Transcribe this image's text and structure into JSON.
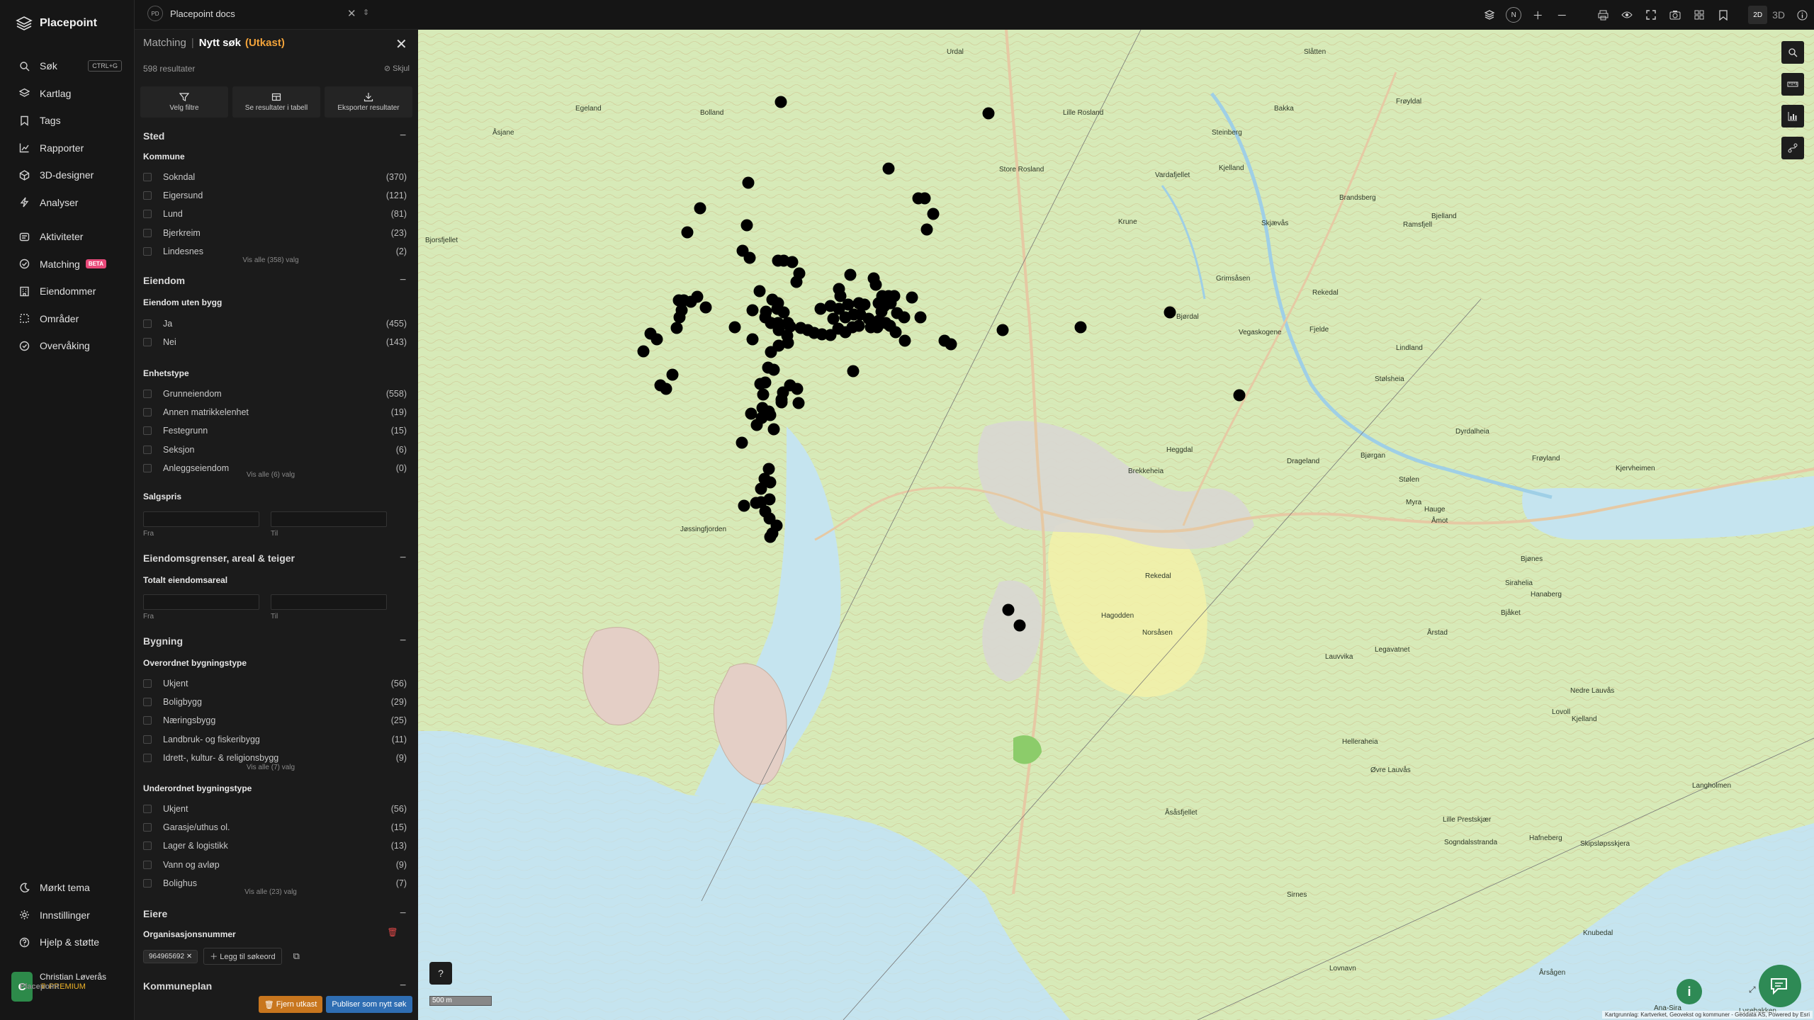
{
  "app": {
    "name": "Placepoint"
  },
  "sidebar": {
    "nav": [
      {
        "label": "Søk",
        "icon": "search-icon",
        "shortcut": "CTRL+G"
      },
      {
        "label": "Kartlag",
        "icon": "layers-icon"
      },
      {
        "label": "Tags",
        "icon": "bookmark-icon"
      },
      {
        "label": "Rapporter",
        "icon": "chart-icon"
      },
      {
        "label": "3D-designer",
        "icon": "cube-icon"
      },
      {
        "label": "Analyser",
        "icon": "bolt-icon"
      }
    ],
    "nav2": [
      {
        "label": "Aktiviteter",
        "icon": "activity-icon"
      },
      {
        "label": "Matching",
        "icon": "target-icon",
        "badge": "BETA"
      },
      {
        "label": "Eiendommer",
        "icon": "building-icon"
      },
      {
        "label": "Områder",
        "icon": "area-icon"
      },
      {
        "label": "Overvåking",
        "icon": "monitor-icon"
      }
    ],
    "nav3": [
      {
        "label": "Mørkt tema",
        "icon": "moon-icon"
      },
      {
        "label": "Innstillinger",
        "icon": "gear-icon"
      },
      {
        "label": "Hjelp & støtte",
        "icon": "help-icon"
      }
    ],
    "user": {
      "initial": "C",
      "name": "Christian Løverås",
      "org": "Placepoint",
      "plan": "PREMIUM"
    }
  },
  "topbar": {
    "workspace_initials": "PD",
    "workspace": "Placepoint docs",
    "compass": "N",
    "mode_2d": "2D",
    "mode_3d": "3D"
  },
  "panel": {
    "crumb": "Matching",
    "title": "Nytt søk",
    "draft": "(Utkast)",
    "result_count": "598 resultater",
    "hide_label": "Skjul",
    "actions": [
      "Velg filtre",
      "Se resultater i tabell",
      "Eksporter resultater"
    ],
    "sted": {
      "title": "Sted",
      "kommune_label": "Kommune",
      "kommune": [
        {
          "label": "Sokndal",
          "count": "(370)"
        },
        {
          "label": "Eigersund",
          "count": "(121)"
        },
        {
          "label": "Lund",
          "count": "(81)"
        },
        {
          "label": "Bjerkreim",
          "count": "(23)"
        },
        {
          "label": "Lindesnes",
          "count": "(2)"
        }
      ],
      "vis_alle": "Vis alle (358) valg"
    },
    "eiendom": {
      "title": "Eiendom",
      "uten_bygg_label": "Eiendom uten bygg",
      "uten_bygg": [
        {
          "label": "Ja",
          "count": "(455)"
        },
        {
          "label": "Nei",
          "count": "(143)"
        }
      ],
      "enhetstype_label": "Enhetstype",
      "enhetstype": [
        {
          "label": "Grunneiendom",
          "count": "(558)"
        },
        {
          "label": "Annen matrikkelenhet",
          "count": "(19)"
        },
        {
          "label": "Festegrunn",
          "count": "(15)"
        },
        {
          "label": "Seksjon",
          "count": "(6)"
        },
        {
          "label": "Anleggseiendom",
          "count": "(0)"
        }
      ],
      "enhetstype_vis_alle": "Vis alle (6) valg",
      "salgspris_label": "Salgspris",
      "fra": "Fra",
      "til": "Til"
    },
    "grenser": {
      "title": "Eiendomsgrenser, areal & teiger",
      "areal_label": "Totalt eiendomsareal",
      "fra": "Fra",
      "til": "Til"
    },
    "bygning": {
      "title": "Bygning",
      "overordnet_label": "Overordnet bygningstype",
      "overordnet": [
        {
          "label": "Ukjent",
          "count": "(56)"
        },
        {
          "label": "Boligbygg",
          "count": "(29)"
        },
        {
          "label": "Næringsbygg",
          "count": "(25)"
        },
        {
          "label": "Landbruk- og fiskeribygg",
          "count": "(11)"
        },
        {
          "label": "Idrett-, kultur- & religionsbygg",
          "count": "(9)"
        }
      ],
      "overordnet_vis_alle": "Vis alle (7) valg",
      "underordnet_label": "Underordnet bygningstype",
      "underordnet": [
        {
          "label": "Ukjent",
          "count": "(56)"
        },
        {
          "label": "Garasje/uthus ol.",
          "count": "(15)"
        },
        {
          "label": "Lager & logistikk",
          "count": "(13)"
        },
        {
          "label": "Vann og avløp",
          "count": "(9)"
        },
        {
          "label": "Bolighus",
          "count": "(7)"
        }
      ],
      "underordnet_vis_alle": "Vis alle (23) valg"
    },
    "eiere": {
      "title": "Eiere",
      "org_label": "Organisasjonsnummer",
      "org_value": "964965692",
      "add_keyword": "Legg til søkeord"
    },
    "kommuneplan": {
      "title": "Kommuneplan"
    },
    "btn_remove": "Fjern utkast",
    "btn_publish": "Publiser som nytt søk"
  },
  "map": {
    "scale_label": "500 m",
    "attribution": "Kartgrunnlag: Kartverket, Geovekst og kommuner - Geodata AS, Powered by Esri",
    "place_labels": [
      {
        "label": "Slåtten"
      },
      {
        "label": "Urdal"
      },
      {
        "label": "Egeland"
      },
      {
        "label": "Bolland"
      },
      {
        "label": "Lille Rosland"
      },
      {
        "label": "Bakka"
      },
      {
        "label": "Frøyldal"
      },
      {
        "label": "Åsjane"
      },
      {
        "label": "Steinberg"
      },
      {
        "label": "Kjelland"
      },
      {
        "label": "Bjorsfjellet"
      },
      {
        "label": "Store Rosland"
      },
      {
        "label": "Vardafjellet"
      },
      {
        "label": "Brandsberg"
      },
      {
        "label": "Bjelland"
      },
      {
        "label": "Skjævås"
      },
      {
        "label": "Bjørdal"
      },
      {
        "label": "Ramsfjell"
      },
      {
        "label": "Krune"
      },
      {
        "label": "Grimsåsen"
      },
      {
        "label": "Rekedal"
      },
      {
        "label": "Fjelde"
      },
      {
        "label": "Vegaskogene"
      },
      {
        "label": "Stølsheia"
      },
      {
        "label": "Lindland"
      },
      {
        "label": "Heggdal"
      },
      {
        "label": "Bjørgan"
      },
      {
        "label": "Dyrdalheia"
      },
      {
        "label": "Stølen"
      },
      {
        "label": "Drageland"
      },
      {
        "label": "Frøyland"
      },
      {
        "label": "Kjervheimen"
      },
      {
        "label": "Brekkeheia"
      },
      {
        "label": "Myra"
      },
      {
        "label": "Hauge"
      },
      {
        "label": "Åmot"
      },
      {
        "label": "Bjønes"
      },
      {
        "label": "Sirahelia"
      },
      {
        "label": "Rekedal"
      },
      {
        "label": "Hagodden"
      },
      {
        "label": "Norsåsen"
      },
      {
        "label": "Årstad"
      },
      {
        "label": "Hanaberg"
      },
      {
        "label": "Bjåket"
      },
      {
        "label": "Lauvvika"
      },
      {
        "label": "Legavatnet"
      },
      {
        "label": "Nedre Lauvås"
      },
      {
        "label": "Lovoll"
      },
      {
        "label": "Helleraheia"
      },
      {
        "label": "Kjelland"
      },
      {
        "label": "Øvre Lauvås"
      },
      {
        "label": "Åsåsfjellet"
      },
      {
        "label": "Lille Prestskjær"
      },
      {
        "label": "Sogndalsstranda"
      },
      {
        "label": "Hafneberg"
      },
      {
        "label": "Skipsløpsskjera"
      },
      {
        "label": "Langholmen"
      },
      {
        "label": "Sirnes"
      },
      {
        "label": "Knubedal"
      },
      {
        "label": "Årsågen"
      },
      {
        "label": "Lovnavn"
      },
      {
        "label": "Lysebakken"
      },
      {
        "label": "Ana-Sira"
      },
      {
        "label": "Jøssingfjorden"
      }
    ]
  }
}
